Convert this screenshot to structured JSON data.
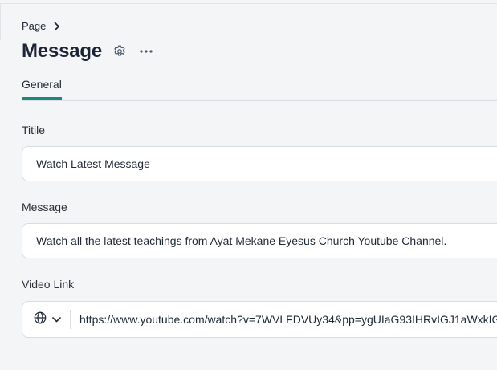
{
  "breadcrumb": {
    "label": "Page"
  },
  "header": {
    "title": "Message"
  },
  "tabs": [
    {
      "label": "General"
    }
  ],
  "form": {
    "title_label": "Titile",
    "title_value": "Watch Latest Message",
    "message_label": "Message",
    "message_value": "Watch all the latest teachings from Ayat Mekane Eyesus Church Youtube Channel.",
    "video_link_label": "Video Link",
    "video_link_value": "https://www.youtube.com/watch?v=7WVLFDVUy34&pp=ygUIaG93IHRvIGJ1aWxkIG"
  },
  "icons": {
    "breadcrumb_chevron": "chevron-right-icon",
    "settings": "gear-icon",
    "more": "ellipsis-icon",
    "url_prefix": "globe-icon",
    "url_dropdown": "chevron-down-icon"
  },
  "colors": {
    "accent": "#1a8a80",
    "background": "#f4f5f7",
    "title": "#1b2536"
  }
}
